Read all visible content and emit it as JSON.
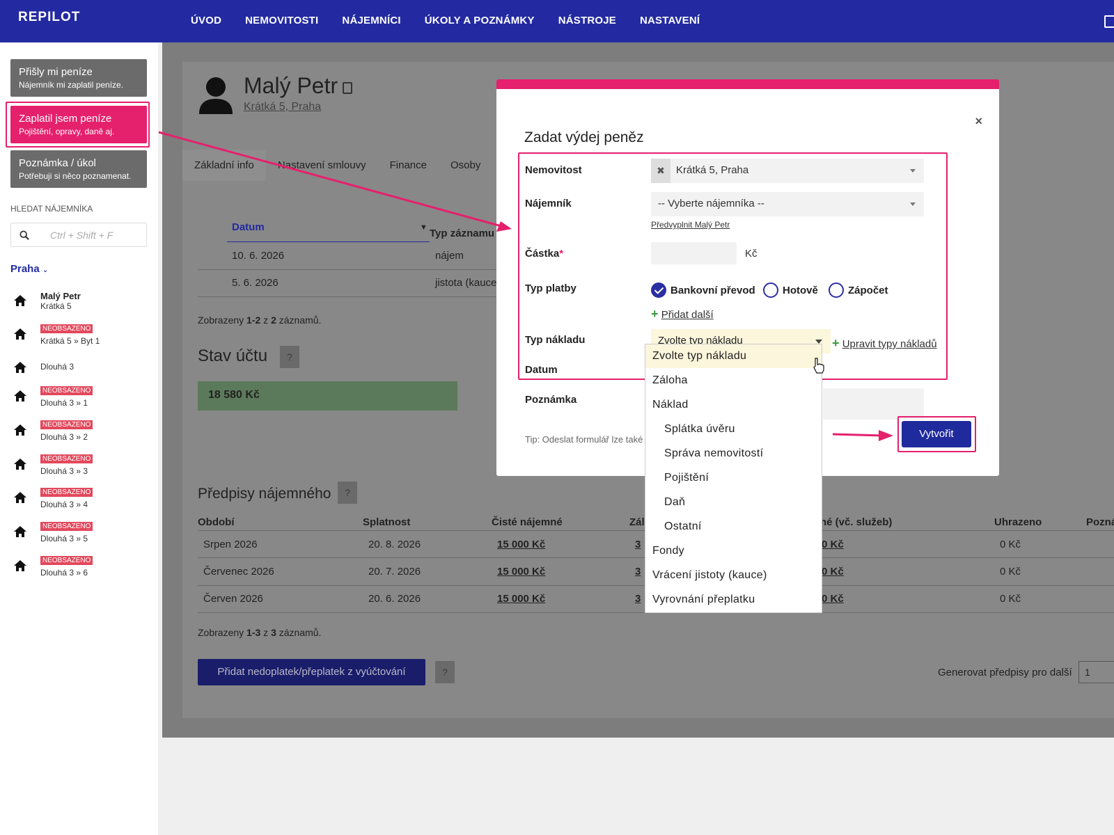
{
  "app": {
    "logo": "REPILOT",
    "nav": [
      "ÚVOD",
      "NEMOVITOSTI",
      "NÁJEMNÍCI",
      "ÚKOLY A POZNÁMKY",
      "NÁSTROJE",
      "NASTAVENÍ"
    ]
  },
  "sidebar": {
    "quick": [
      {
        "title": "Přišly mi peníze",
        "subtitle": "Nájemník mi zaplatil peníze."
      },
      {
        "title": "Zaplatil jsem peníze",
        "subtitle": "Pojištění, opravy, daně aj."
      },
      {
        "title": "Poznámka / úkol",
        "subtitle": "Potřebuji si něco poznamenat."
      }
    ],
    "search_title": "HLEDAT NÁJEMNÍKA",
    "search_placeholder": "Ctrl + Shift + F",
    "city": "Praha",
    "properties": [
      {
        "name": "Malý Petr",
        "sub": "Krátká 5",
        "badge": ""
      },
      {
        "name": "",
        "sub": "Krátká 5 » Byt 1",
        "badge": "NEOBSAZENO"
      },
      {
        "name": "",
        "sub": "Dlouhá 3",
        "badge": ""
      },
      {
        "name": "",
        "sub": "Dlouhá 3 » 1",
        "badge": "NEOBSAZENO"
      },
      {
        "name": "",
        "sub": "Dlouhá 3 » 2",
        "badge": "NEOBSAZENO"
      },
      {
        "name": "",
        "sub": "Dlouhá 3 » 3",
        "badge": "NEOBSAZENO"
      },
      {
        "name": "",
        "sub": "Dlouhá 3 » 4",
        "badge": "NEOBSAZENO"
      },
      {
        "name": "",
        "sub": "Dlouhá 3 » 5",
        "badge": "NEOBSAZENO"
      },
      {
        "name": "",
        "sub": "Dlouhá 3 » 6",
        "badge": "NEOBSAZENO"
      }
    ]
  },
  "tenant": {
    "name": "Malý Petr",
    "address": "Krátká 5, Praha",
    "tabs": [
      "Základní info",
      "Nastavení smlouvy",
      "Finance",
      "Osoby"
    ]
  },
  "records": {
    "headers": [
      "Datum",
      "Typ záznamu"
    ],
    "rows": [
      {
        "date": "10. 6. 2026",
        "type": "nájem"
      },
      {
        "date": "5. 6. 2026",
        "type": "jistota (kauce"
      }
    ],
    "summary_prefix": "Zobrazeny ",
    "summary_range": "1-2",
    "summary_mid": " z ",
    "summary_total": "2",
    "summary_suffix": " záznamů."
  },
  "account": {
    "title": "Stav účtu",
    "balance": "18 580 Kč",
    "help": "?"
  },
  "rent": {
    "title": "Předpisy nájemného",
    "help": "?",
    "headers": [
      "Období",
      "Splatnost",
      "Čisté nájemné",
      "Zál",
      "né (vč. služeb)",
      "Uhrazeno",
      "Pozná"
    ],
    "rows": [
      {
        "period": "Srpen 2026",
        "due": "20. 8. 2026",
        "net": "15 000 Kč",
        "dep": "3",
        "total": "0 Kč",
        "paid": "0 Kč"
      },
      {
        "period": "Červenec 2026",
        "due": "20. 7. 2026",
        "net": "15 000 Kč",
        "dep": "3",
        "total": "0 Kč",
        "paid": "0 Kč"
      },
      {
        "period": "Červen 2026",
        "due": "20. 6. 2026",
        "net": "15 000 Kč",
        "dep": "3",
        "total": "0 Kč",
        "paid": "0 Kč"
      }
    ],
    "summary_prefix": "Zobrazeny ",
    "summary_range": "1-3",
    "summary_mid": " z ",
    "summary_total": "3",
    "summary_suffix": " záznamů.",
    "add_button": "Přidat nedoplatek/přeplatek z vyúčtování",
    "generate_label": "Generovat předpisy pro další",
    "generate_value": "1"
  },
  "modal": {
    "title": "Zadat výdej peněz",
    "close": "×",
    "labels": {
      "property": "Nemovitost",
      "tenant": "Nájemník",
      "amount": "Částka",
      "required_mark": "*",
      "payment_type": "Typ platby",
      "cost_type": "Typ nákladu",
      "date": "Datum",
      "note": "Poznámka"
    },
    "property_value": "Krátká 5, Praha",
    "tenant_placeholder": "-- Vyberte nájemníka --",
    "prefill_link": "Předvyplnit Malý Petr",
    "currency": "Kč",
    "payment_options": [
      {
        "label": "Bankovní převod",
        "checked": true
      },
      {
        "label": "Hotově",
        "checked": false
      },
      {
        "label": "Zápočet",
        "checked": false
      }
    ],
    "add_more": "Přidat další",
    "cost_select_value": "Zvolte typ nákladu",
    "edit_cost_types": "Upravit typy nákladů",
    "tip": "Tip: Odeslat formulář lze také",
    "create_button": "Vytvořit",
    "cost_options": [
      {
        "label": "Zvolte typ nákladu",
        "level": 0,
        "selected": true
      },
      {
        "label": "Záloha",
        "level": 0
      },
      {
        "label": "Náklad",
        "level": 0
      },
      {
        "label": "Splátka úvěru",
        "level": 1
      },
      {
        "label": "Správa nemovitostí",
        "level": 1
      },
      {
        "label": "Pojištění",
        "level": 1
      },
      {
        "label": "Daň",
        "level": 1
      },
      {
        "label": "Ostatní",
        "level": 1
      },
      {
        "label": "Fondy",
        "level": 0
      },
      {
        "label": "Vrácení jistoty (kauce)",
        "level": 0
      },
      {
        "label": "Vyrovnání přeplatku",
        "level": 0
      }
    ]
  },
  "colors": {
    "nav": "#232aa1",
    "accent": "#e5206d",
    "primary_button": "#1f2a9c",
    "badge": "#e2495d"
  }
}
